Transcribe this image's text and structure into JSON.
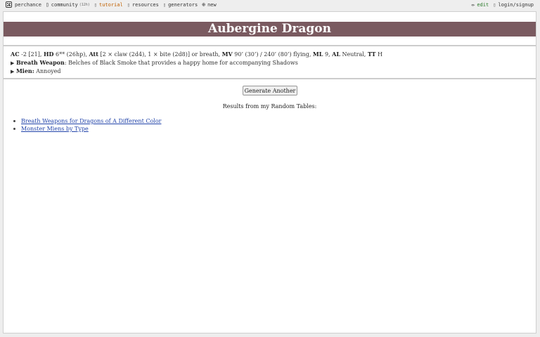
{
  "nav": {
    "brand": "perchance",
    "community": "community",
    "community_count": "(12h)",
    "tutorial": "tutorial",
    "resources": "resources",
    "generators": "generators",
    "new": "new",
    "edit": "edit",
    "login": "login/signup",
    "icons": [
      "dice-icon",
      "chat-icon",
      "book-icon",
      "folder-icon",
      "grid-icon",
      "plus-circle-icon",
      "pencil-icon",
      "user-icon"
    ]
  },
  "main": {
    "title": "Aubergine Dragon",
    "title_bg": "#7a5a60",
    "stats": {
      "ac_label": "AC",
      "ac_value": "-2 [21],",
      "hd_label": "HD",
      "hd_value": "6** (26hp),",
      "att_label": "Att",
      "att_value": "[2 × claw (2d4), 1 × bite (2d8)] or breath,",
      "mv_label": "MV",
      "mv_value": "90’ (30’) / 240’ (80’) flying,",
      "ml_label": "ML",
      "ml_value": "9,",
      "al_label": "AL",
      "al_value": "Neutral,",
      "tt_label": "TT",
      "tt_value": "H"
    },
    "breath": {
      "arrow": "▶",
      "label": "Breath Weapon",
      "text": ": Belches of Black Smoke that provides a happy home for accompanying Shadows"
    },
    "mien": {
      "arrow": "▶",
      "label": "Mien:",
      "text": "Annoyed"
    },
    "generate_button": "Generate Another",
    "results_heading": "Results from my Random Tables:",
    "links": [
      "Breath Weapons for Dragons of A Different Color",
      "Monster Miens by Type"
    ]
  }
}
